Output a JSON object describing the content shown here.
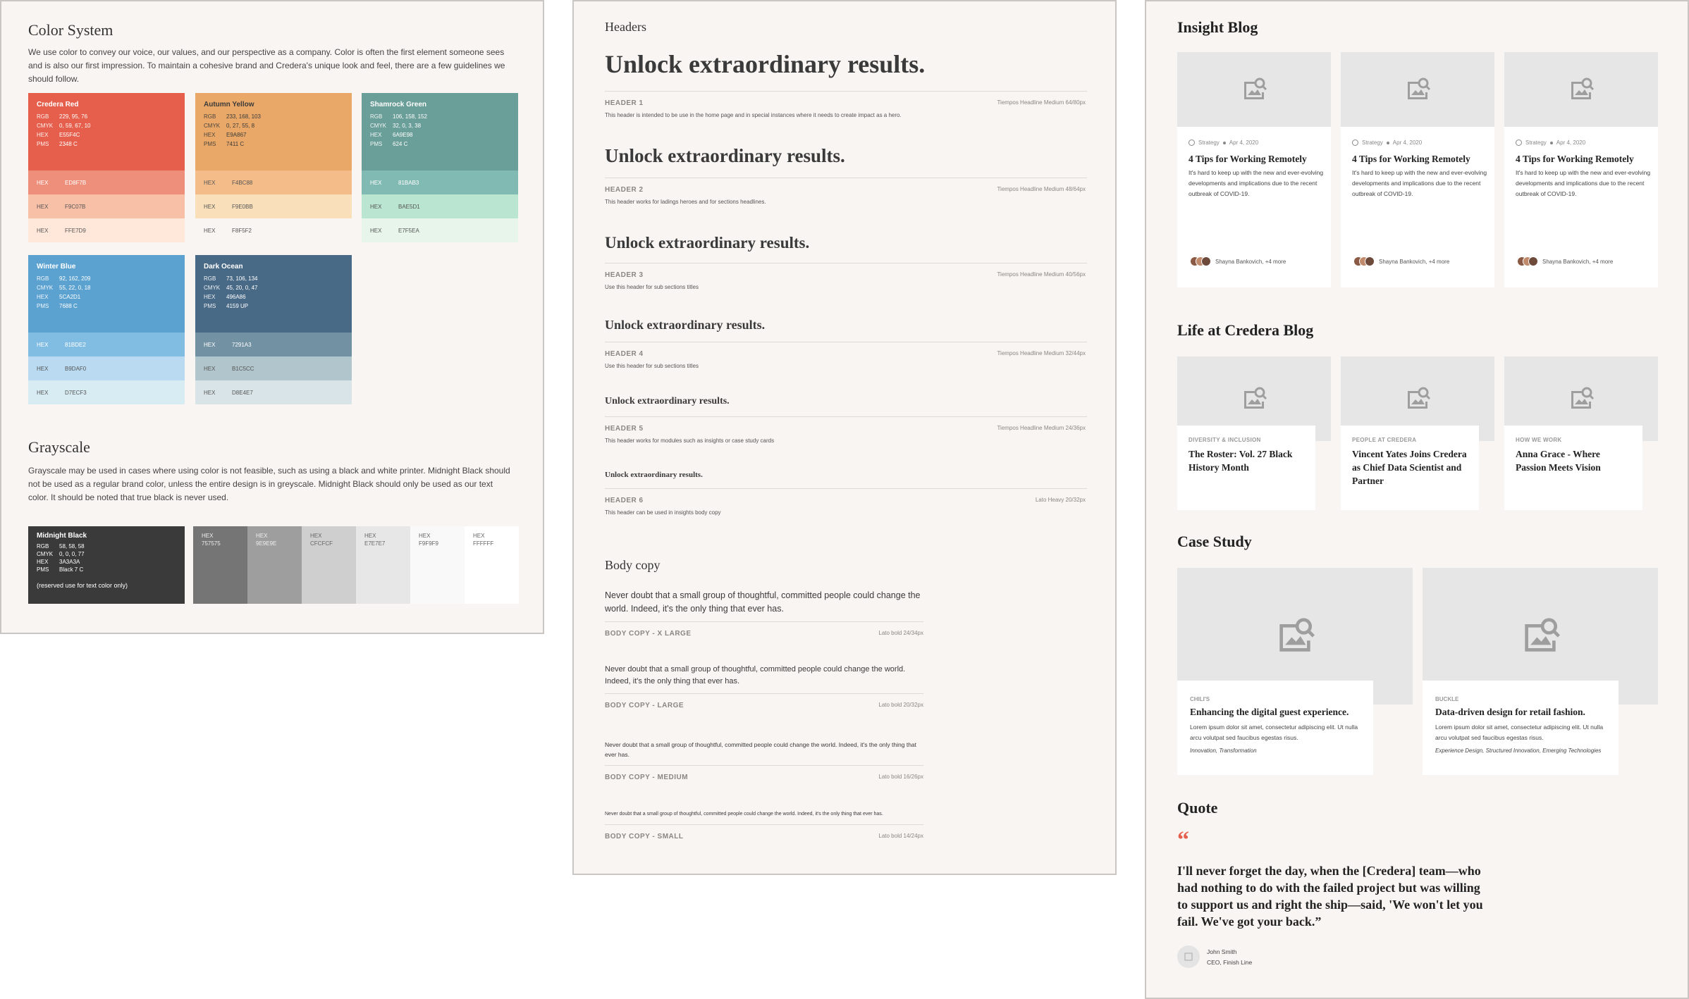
{
  "color_system": {
    "title": "Color System",
    "intro": "We use color to convey our voice, our values, and our perspective as a company. Color is often the first element someone sees and is also our first impression. To maintain a cohesive brand and Credera's unique look and feel, there are a few guidelines we should follow.",
    "colors": [
      {
        "name": "Credera Red",
        "rgb": "229, 95, 76",
        "cmyk": "0, 59, 67, 10",
        "hex": "E55F4C",
        "pms": "2348 C",
        "bg": "#E55F4C",
        "text_dark": false,
        "tints": [
          {
            "label": "HEX",
            "value": "ED8F7B",
            "bg": "#ED8F7B"
          },
          {
            "label": "HEX",
            "value": "F9C07B",
            "bg": "#F9C0A8"
          },
          {
            "label": "HEX",
            "value": "FFE7D9",
            "bg": "#FFE7D9"
          }
        ]
      },
      {
        "name": "Autumn Yellow",
        "rgb": "233, 168, 103",
        "cmyk": "0, 27, 55, 8",
        "hex": "E9A867",
        "pms": "7411 C",
        "bg": "#E9A867",
        "text_dark": true,
        "tints": [
          {
            "label": "HEX",
            "value": "F4BC88",
            "bg": "#F4BC88"
          },
          {
            "label": "HEX",
            "value": "F9E0BB",
            "bg": "#F9E0BB"
          },
          {
            "label": "HEX",
            "value": "F8F5F2",
            "bg": "#F8F5F2"
          }
        ]
      },
      {
        "name": "Shamrock Green",
        "rgb": "106, 158, 152",
        "cmyk": "32, 0, 3, 38",
        "hex": "6A9E98",
        "pms": "624 C",
        "bg": "#6A9E98",
        "text_dark": false,
        "tints": [
          {
            "label": "HEX",
            "value": "81BAB3",
            "bg": "#81BAB3"
          },
          {
            "label": "HEX",
            "value": "BAE5D1",
            "bg": "#BAE5D1"
          },
          {
            "label": "HEX",
            "value": "E7F5EA",
            "bg": "#E7F5EA"
          }
        ]
      },
      {
        "name": "Winter Blue",
        "rgb": "92, 162, 209",
        "cmyk": "55, 22, 0, 18",
        "hex": "5CA2D1",
        "pms": "7688 C",
        "bg": "#5CA2D1",
        "text_dark": false,
        "tints": [
          {
            "label": "HEX",
            "value": "81BDE2",
            "bg": "#81BDE2"
          },
          {
            "label": "HEX",
            "value": "B9DAF0",
            "bg": "#B9DAF0"
          },
          {
            "label": "HEX",
            "value": "D7ECF3",
            "bg": "#D7ECF3"
          }
        ]
      },
      {
        "name": "Dark Ocean",
        "rgb": "73, 106, 134",
        "cmyk": "45, 20, 0, 47",
        "hex": "496A86",
        "pms": "4159 UP",
        "bg": "#496A86",
        "text_dark": false,
        "tints": [
          {
            "label": "HEX",
            "value": "7291A3",
            "bg": "#7291A3"
          },
          {
            "label": "HEX",
            "value": "B1C5CC",
            "bg": "#B1C5CC"
          },
          {
            "label": "HEX",
            "value": "D8E4E7",
            "bg": "#D8E4E7"
          }
        ]
      }
    ],
    "labels": {
      "rgb": "RGB",
      "cmyk": "CMYK",
      "hex": "HEX",
      "pms": "PMS"
    }
  },
  "grayscale": {
    "title": "Grayscale",
    "intro": "Grayscale may be used in cases where using color is not feasible, such as using a black and white printer.  Midnight Black should not be used as a regular brand color, unless the entire design is in greyscale. Midnight Black should only be used as our text color. It should be noted that true black is never used.",
    "midnight": {
      "name": "Midnight Black",
      "rgb": "58, 58, 58",
      "cmyk": "0, 0, 0, 77",
      "hex": "3A3A3A",
      "pms": "Black 7 C",
      "note": "(reserved use for text color only)"
    },
    "swatches": [
      {
        "label": "HEX",
        "value": "757575",
        "bg": "#757575",
        "dark": false
      },
      {
        "label": "HEX",
        "value": "9E9E9E",
        "bg": "#9E9E9E",
        "dark": false
      },
      {
        "label": "HEX",
        "value": "CFCFCF",
        "bg": "#CFCFCF",
        "dark": true
      },
      {
        "label": "HEX",
        "value": "E7E7E7",
        "bg": "#E7E7E7",
        "dark": true
      },
      {
        "label": "HEX",
        "value": "F9F9F9",
        "bg": "#F9F9F9",
        "dark": true
      },
      {
        "label": "HEX",
        "value": "FFFFFF",
        "bg": "#FFFFFF",
        "dark": true
      }
    ]
  },
  "headers": {
    "title": "Headers",
    "items": [
      {
        "sample": "Unlock extraordinary results.",
        "label": "HEADER 1",
        "spec": "Tiempos Headline Medium 64/80px",
        "desc": "This header is intended to be use in the home page and in special instances where it needs to create impact as a hero."
      },
      {
        "sample": "Unlock extraordinary results.",
        "label": "HEADER 2",
        "spec": "Tiempos Headline Medium  48/64px",
        "desc": "This header works for ladings heroes and for sections headlines."
      },
      {
        "sample": "Unlock extraordinary results.",
        "label": "HEADER 3",
        "spec": "Tiempos Headline Medium 40/56px",
        "desc": "Use this header for sub sections titles"
      },
      {
        "sample": "Unlock extraordinary results.",
        "label": "HEADER 4",
        "spec": "Tiempos Headline Medium 32/44px",
        "desc": "Use this header for sub sections titles"
      },
      {
        "sample": "Unlock extraordinary results.",
        "label": "HEADER 5",
        "spec": "Tiempos Headline Medium 24/36px",
        "desc": "This header works for modules such as insights or case study cards"
      },
      {
        "sample": "Unlock extraordinary results.",
        "label": "HEADER 6",
        "spec": "Lato Heavy 20/32px",
        "desc": "This header can be used in insights body copy"
      }
    ]
  },
  "body_copy": {
    "title": "Body copy",
    "items": [
      {
        "sample": "Never doubt that a small group of thoughtful, committed people could change the world. Indeed, it's the only thing that ever has.",
        "label": "BODY COPY - X LARGE",
        "spec": "Lato bold 24/34px"
      },
      {
        "sample": "Never doubt that a small group of thoughtful, committed people could change the world. Indeed, it's the only thing that ever has.",
        "label": "BODY COPY - LARGE",
        "spec": "Lato bold  20/32px"
      },
      {
        "sample": "Never doubt that a small group of thoughtful, committed people could change the world. Indeed, it's the only thing that ever has.",
        "label": "BODY COPY - MEDIUM",
        "spec": "Lato bold 16/26px"
      },
      {
        "sample": "Never doubt that a small group of thoughtful, committed people could change the world. Indeed, it's the only thing that ever has.",
        "label": "BODY COPY - SMALL",
        "spec": "Lato bold  14/24px"
      }
    ]
  },
  "insight_blog": {
    "title": "Insight Blog",
    "cards": [
      {
        "category": "Strategy",
        "date": "Apr 4, 2020",
        "title": "4 Tips for Working Remotely",
        "excerpt": "It's hard to keep up with the new and ever-evolving developments and implications due to the recent outbreak of COVID-19.",
        "author": "Shayna Bankovich, +4 more"
      },
      {
        "category": "Strategy",
        "date": "Apr 4, 2020",
        "title": "4 Tips for Working Remotely",
        "excerpt": "It's hard to keep up with the new and ever-evolving developments and implications due to the recent outbreak of COVID-19.",
        "author": "Shayna Bankovich, +4 more"
      },
      {
        "category": "Strategy",
        "date": "Apr 4, 2020",
        "title": "4 Tips for Working Remotely",
        "excerpt": "It's hard to keep up with the new and ever-evolving developments and implications due to the recent outbreak of COVID-19.",
        "author": "Shayna Bankovich, +4 more"
      }
    ]
  },
  "life_blog": {
    "title": "Life at Credera Blog",
    "cards": [
      {
        "category": "DIVERSITY & INCLUSION",
        "title": "The Roster: Vol. 27 Black History Month"
      },
      {
        "category": "PEOPLE AT CREDERA",
        "title": "Vincent Yates Joins Credera as Chief Data Scientist and Partner"
      },
      {
        "category": "HOW WE WORK",
        "title": "Anna Grace - Where Passion Meets Vision"
      }
    ]
  },
  "case_study": {
    "title": "Case Study",
    "cards": [
      {
        "client": "CHILI'S",
        "title": "Enhancing the digital guest experience.",
        "body": "Lorem ipsum dolor sit amet, consectetur adipiscing elit. Ut nulla arcu volutpat sed faucibus egestas risus.",
        "tags": "Innovation, Transformation"
      },
      {
        "client": "BUCKLE",
        "title": "Data-driven design for retail fashion.",
        "body": "Lorem ipsum dolor sit amet, consectetur adipiscing elit. Ut nulla arcu volutpat sed faucibus egestas risus.",
        "tags": "Experience Design, Structured Innovation, Emerging Technologies"
      }
    ]
  },
  "quote": {
    "title": "Quote",
    "mark": "“",
    "text": "I'll never forget the day, when the [Credera] team—who had nothing to do with the failed project but was willing to support us and right the ship—said, 'We won't let you fail. We've got your back.”",
    "name": "John Smith",
    "role": "CEO, Finish Line",
    "accent": "#E55F4C"
  }
}
